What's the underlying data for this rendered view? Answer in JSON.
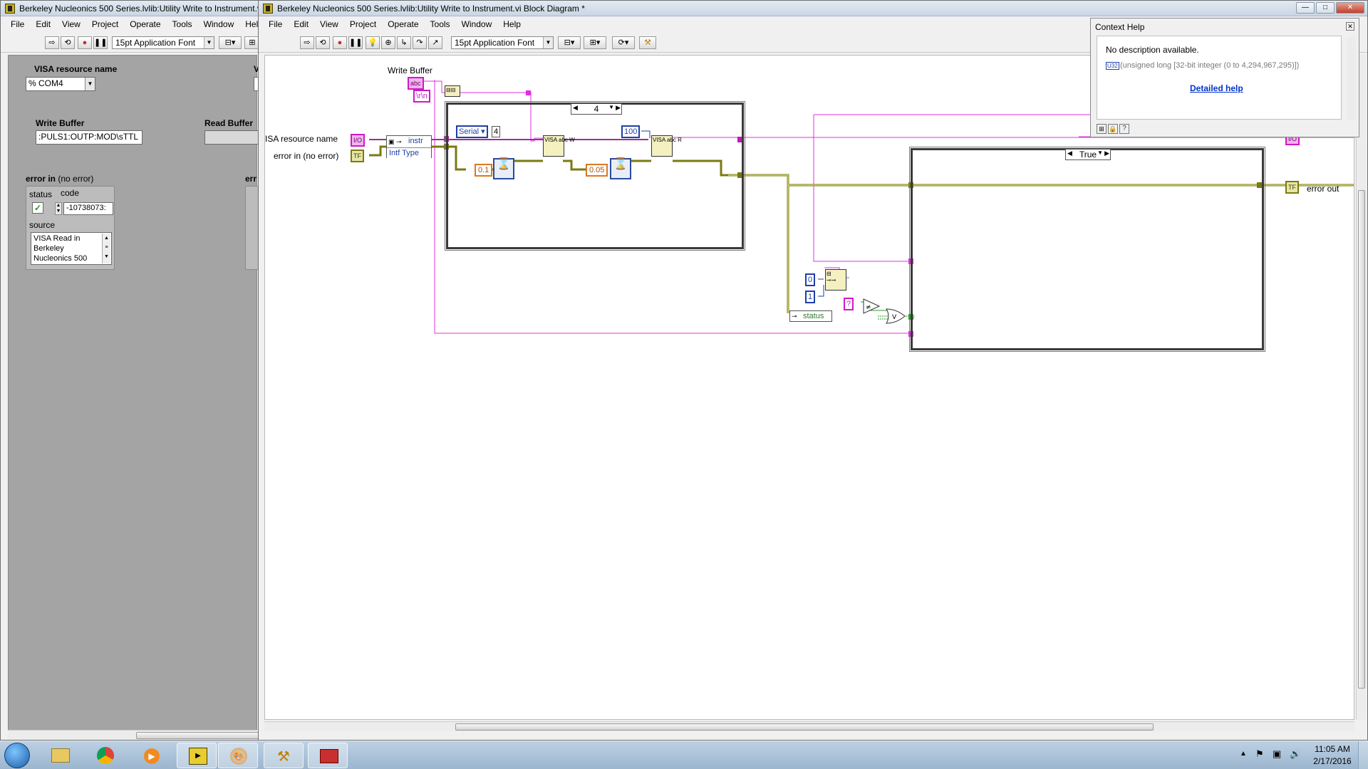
{
  "front_panel": {
    "title": "Berkeley Nucleonics 500 Series.lvlib:Utility Write to Instrument.vi Front Panel *",
    "menu": [
      "File",
      "Edit",
      "View",
      "Project",
      "Operate",
      "Tools",
      "Window",
      "Help"
    ],
    "font_label": "15pt Application Font",
    "visa_label": "VISA resource name",
    "visa_value": "COM4",
    "visa_prefix": "%",
    "write_buffer_label": "Write Buffer",
    "write_buffer_value": ":PULS1:OUTP:MOD\\sTTL",
    "read_buffer_label": "Read Buffer",
    "error_in_label_bold": "error in",
    "error_in_label_rest": " (no error)",
    "status_label": "status",
    "code_label": "code",
    "code_value": "-10738073:",
    "source_label": "source",
    "source_value": "VISA Read in Berkeley Nucleonics 500",
    "visa_label_2": "V",
    "error_label_2": "err"
  },
  "block_diagram": {
    "title": "Berkeley Nucleonics 500 Series.lvlib:Utility Write to Instrument.vi Block Diagram *",
    "menu": [
      "File",
      "Edit",
      "View",
      "Project",
      "Operate",
      "Tools",
      "Window",
      "Help"
    ],
    "font_label": "15pt Application Font",
    "labels": {
      "write_buffer": "Write Buffer",
      "visa_resource": "ISA resource name",
      "error_in": "error in (no error)",
      "error_out": "error out"
    },
    "constants": {
      "crlf": "\\r\\n",
      "serial_enum": "Serial",
      "serial_num": "4",
      "wait_1": "0.1",
      "wait_2": "0.05",
      "bytes": "100",
      "zero": "0",
      "one": "1",
      "question": "?"
    },
    "nodes": {
      "prop_instr": "instr",
      "prop_intf": "Intf Type",
      "status": "status",
      "visa_write": "VISA abc W",
      "visa_read": "VISA abc R",
      "io_term": "I/O",
      "abc_term": "abc",
      "err_term": "TF"
    },
    "case_selector_1": "4",
    "case_selector_2": "True"
  },
  "context_help": {
    "title": "Context Help",
    "description": "No description available.",
    "type_text": "(unsigned long [32-bit integer (0 to 4,294,967,295)])",
    "type_icon": "U32",
    "link": "Detailed help"
  },
  "taskbar": {
    "time": "11:05 AM",
    "date": "2/17/2016",
    "apps": [
      "windows-start",
      "file-explorer",
      "chrome",
      "media-player",
      "labview",
      "paint",
      "tools",
      "toolbox"
    ]
  },
  "colors": {
    "wire_visa": "#9c2e9a",
    "wire_error": "#7a7a10",
    "wire_string": "#e030e0",
    "wire_numeric": "#1f3fa8",
    "wire_bool": "#2f9a2f"
  }
}
